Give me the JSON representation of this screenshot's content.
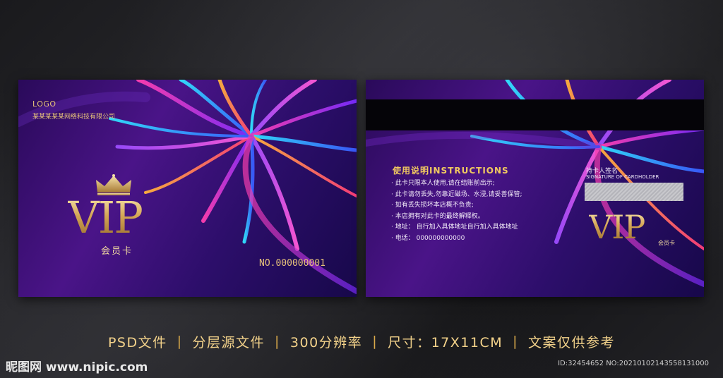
{
  "front_card": {
    "logo": "LOGO",
    "company": "某某某某某网络科技有限公司",
    "vip": "VIP",
    "member_label": "会员卡",
    "card_number": "NO.000000001"
  },
  "back_card": {
    "instructions_title": "使用说明INSTRUCTIONS",
    "instructions": [
      "此卡只限本人使用,请在结账前出示;",
      "此卡请勿丢失,勿靠近磁场、水浸,请妥善保管;",
      "如有丢失损坏本店概不负责;",
      "本店拥有对此卡的最终解释权。",
      "地址：  自行加入具体地址自行加入具体地址",
      "电话：  000000000000"
    ],
    "signature_label": "持卡人签名",
    "signature_label_en": "SIGNATURE OF CARDHOLDER",
    "vip": "VIP",
    "member_label": "会员卡"
  },
  "info_bar": [
    "PSD文件",
    "分层源文件",
    "300分辨率",
    "尺寸：17X11CM",
    "文案仅供参考"
  ],
  "watermark": "昵图网 www.nipic.com",
  "image_id": "ID:32454652 NO:20210102143558131000",
  "colors": {
    "card_purple": "#4a1488",
    "gold": "#d4a555",
    "background": "#141416"
  }
}
